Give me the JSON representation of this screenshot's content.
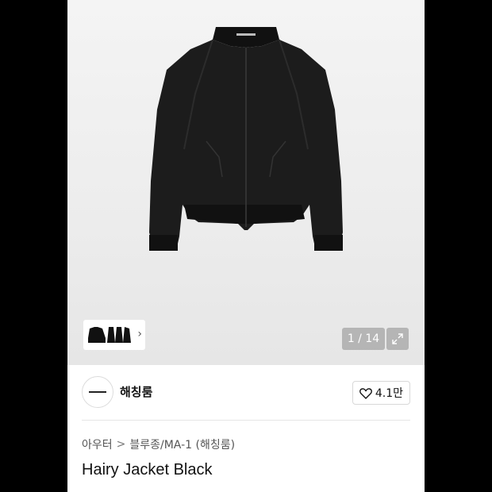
{
  "gallery": {
    "counter": "1 / 14",
    "icons": {
      "expand": "expand-icon",
      "thumb_next": "chevron-right-icon"
    }
  },
  "brand": {
    "name": "해칭룸",
    "likes": "4.1만",
    "icons": {
      "like": "heart-icon"
    }
  },
  "breadcrumb": {
    "items": [
      "아우터",
      "블루종/MA-1 (해칭룸)"
    ],
    "separator": ">"
  },
  "product": {
    "title": "Hairy Jacket Black"
  },
  "colors": {
    "jacket": "#1c1c1c",
    "background": "#ededed",
    "overlay": "#8a8a8a"
  }
}
